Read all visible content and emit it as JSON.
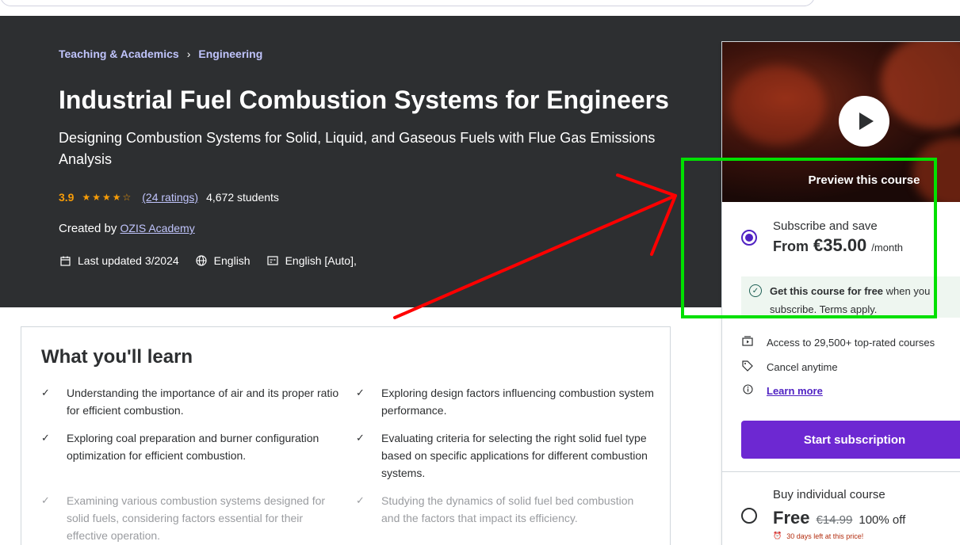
{
  "search": {
    "placeholder": ""
  },
  "breadcrumb": {
    "items": [
      "Teaching & Academics",
      "Engineering"
    ],
    "separator": "›"
  },
  "course": {
    "title": "Industrial Fuel Combustion Systems for Engineers",
    "subtitle": "Designing Combustion Systems for Solid, Liquid, and Gaseous Fuels with Flue Gas Emissions Analysis",
    "rating": "3.9",
    "stars": "★★★★☆",
    "ratings_count": "(24 ratings)",
    "students": "4,672 students",
    "created_by_label": "Created by",
    "author": "OZIS Academy",
    "last_updated": "Last updated 3/2024",
    "language": "English",
    "captions": "English [Auto],"
  },
  "learn": {
    "title": "What you'll learn",
    "items": [
      "Understanding the importance of air and its proper ratio for efficient combustion.",
      "Exploring design factors influencing combustion system performance.",
      "Exploring coal preparation and burner configuration optimization for efficient combustion.",
      "Evaluating criteria for selecting the right solid fuel type based on specific applications for different combustion systems.",
      "Examining various combustion systems designed for solid fuels, considering factors essential for their effective operation.",
      "Studying the dynamics of solid fuel bed combustion and the factors that impact its efficiency."
    ]
  },
  "sidebar": {
    "preview_label": "Preview this course",
    "subscribe_label": "Subscribe and save",
    "from_label": "From",
    "price": "€35.00",
    "per_month": "/month",
    "free_bold": "Get this course for free",
    "free_rest": " when you subscribe. Terms apply.",
    "features": [
      "Access to 29,500+ top-rated courses",
      "Cancel anytime",
      "Learn more"
    ],
    "start_button": "Start subscription",
    "buy_label": "Buy individual course",
    "buy_price": "Free",
    "old_price": "€14.99",
    "discount": "100% off",
    "deadline": "30 days left at this price!"
  },
  "colors": {
    "accent": "#6d28d2",
    "link_light": "#c0c4fc",
    "star": "#f69c08",
    "annotation_box": "#00e000",
    "annotation_arrow": "#ff0000"
  },
  "icons": [
    "chevron-right-icon",
    "calendar-icon",
    "globe-icon",
    "captions-icon",
    "check-icon",
    "play-icon",
    "check-badge-icon",
    "courses-icon",
    "tag-icon",
    "info-icon",
    "alarm-icon"
  ]
}
